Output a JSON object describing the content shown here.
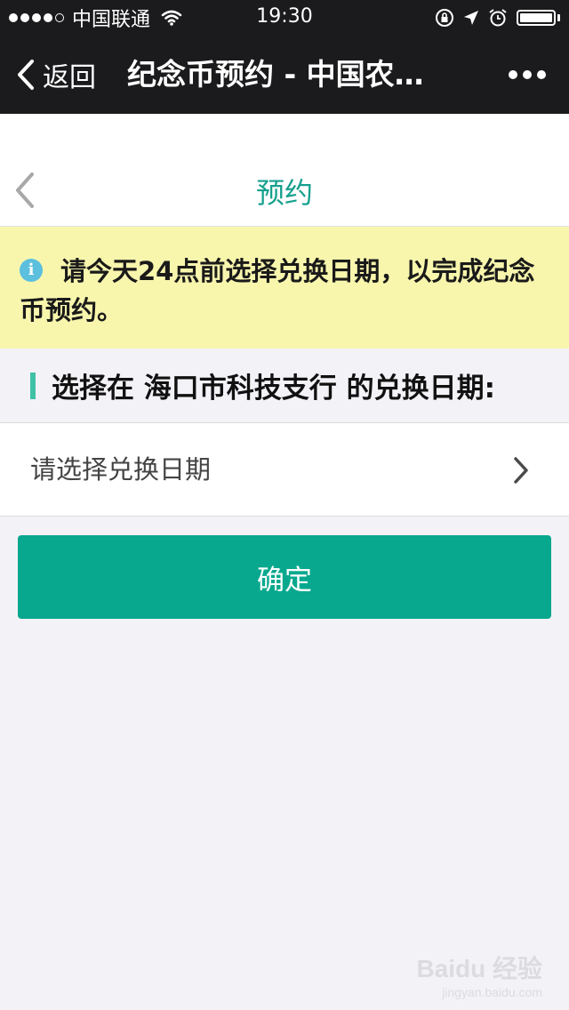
{
  "status_bar": {
    "carrier": "中国联通",
    "time": "19:30"
  },
  "nav": {
    "back_label": "返回",
    "title": "纪念币预约 - 中国农…"
  },
  "header": {
    "title": "预约"
  },
  "notice": {
    "text": "请今天24点前选择兑换日期，以完成纪念币预约。"
  },
  "section": {
    "heading": "选择在 海口市科技支行 的兑换日期:"
  },
  "date_select": {
    "placeholder": "请选择兑换日期"
  },
  "confirm_button": {
    "label": "确定"
  },
  "watermark": {
    "main": "Baidu 经验",
    "sub": "jingyan.baidu.com"
  },
  "colors": {
    "nav_bg": "#1b1b1d",
    "accent": "#16a08e",
    "button": "#08a88e",
    "notice_bg": "#f8f6ad",
    "info_icon": "#5cbfde",
    "page_bg": "#f3f2f7"
  },
  "icons": {
    "back": "chevron-left-icon",
    "more": "more-dots-icon",
    "info": "info-icon",
    "select": "chevron-right-icon"
  }
}
